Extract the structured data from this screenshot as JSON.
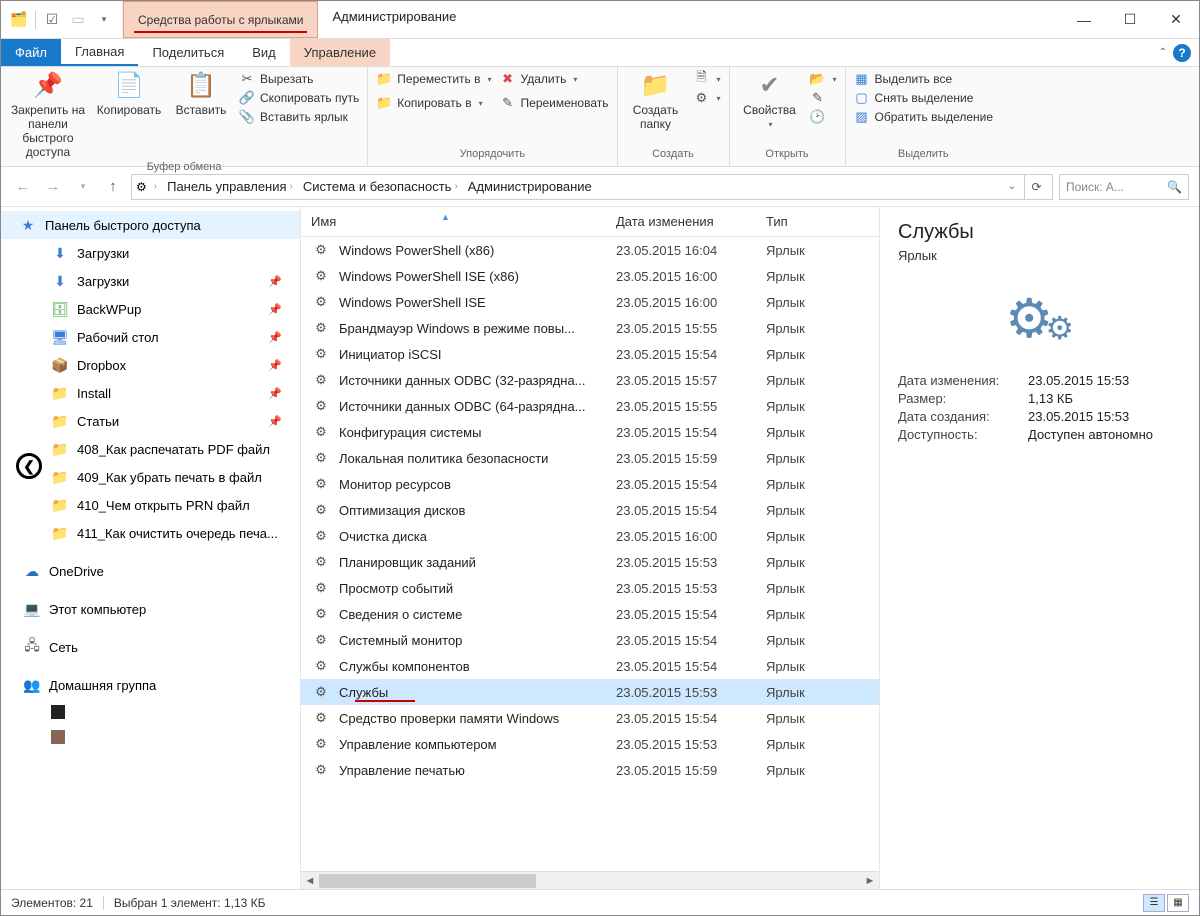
{
  "titlebar": {
    "context_tab": "Средства работы с ярлыками",
    "title": "Администрирование"
  },
  "tabs": {
    "file": "Файл",
    "home": "Главная",
    "share": "Поделиться",
    "view": "Вид",
    "manage": "Управление"
  },
  "ribbon": {
    "pin": "Закрепить на панели быстрого доступа",
    "copy": "Копировать",
    "paste": "Вставить",
    "cut": "Вырезать",
    "copy_path": "Скопировать путь",
    "paste_shortcut": "Вставить ярлык",
    "group_clipboard": "Буфер обмена",
    "move_to": "Переместить в",
    "copy_to": "Копировать в",
    "delete": "Удалить",
    "rename": "Переименовать",
    "group_organize": "Упорядочить",
    "new_folder": "Создать папку",
    "group_new": "Создать",
    "properties": "Свойства",
    "group_open": "Открыть",
    "select_all": "Выделить все",
    "select_none": "Снять выделение",
    "invert_selection": "Обратить выделение",
    "group_select": "Выделить"
  },
  "breadcrumb": {
    "level0": "Панель управления",
    "level1": "Система и безопасность",
    "level2": "Администрирование"
  },
  "search_placeholder": "Поиск: А...",
  "nav": {
    "quick_access": "Панель быстрого доступа",
    "downloads": "Загрузки",
    "backwpup": "BackWPup",
    "desktop": "Рабочий стол",
    "dropbox": "Dropbox",
    "install": "Install",
    "articles": "Статьи",
    "a408": "408_Как распечатать PDF файл",
    "a409": "409_Как убрать печать в файл",
    "a410": "410_Чем открыть PRN файл",
    "a411": "411_Как очистить очередь печа...",
    "onedrive": "OneDrive",
    "thispc": "Этот компьютер",
    "network": "Сеть",
    "homegroup": "Домашняя группа"
  },
  "headers": {
    "name": "Имя",
    "date": "Дата изменения",
    "type": "Тип"
  },
  "type_label": "Ярлык",
  "files": [
    {
      "name": "Windows PowerShell (x86)",
      "date": "23.05.2015 16:04"
    },
    {
      "name": "Windows PowerShell ISE (x86)",
      "date": "23.05.2015 16:00"
    },
    {
      "name": "Windows PowerShell ISE",
      "date": "23.05.2015 16:00"
    },
    {
      "name": "Брандмауэр Windows в режиме повы...",
      "date": "23.05.2015 15:55"
    },
    {
      "name": "Инициатор iSCSI",
      "date": "23.05.2015 15:54"
    },
    {
      "name": "Источники данных ODBC (32-разрядна...",
      "date": "23.05.2015 15:57"
    },
    {
      "name": "Источники данных ODBC (64-разрядна...",
      "date": "23.05.2015 15:55"
    },
    {
      "name": "Конфигурация системы",
      "date": "23.05.2015 15:54"
    },
    {
      "name": "Локальная политика безопасности",
      "date": "23.05.2015 15:59"
    },
    {
      "name": "Монитор ресурсов",
      "date": "23.05.2015 15:54"
    },
    {
      "name": "Оптимизация дисков",
      "date": "23.05.2015 15:54"
    },
    {
      "name": "Очистка диска",
      "date": "23.05.2015 16:00"
    },
    {
      "name": "Планировщик заданий",
      "date": "23.05.2015 15:53"
    },
    {
      "name": "Просмотр событий",
      "date": "23.05.2015 15:53"
    },
    {
      "name": "Сведения о системе",
      "date": "23.05.2015 15:54"
    },
    {
      "name": "Системный монитор",
      "date": "23.05.2015 15:54"
    },
    {
      "name": "Службы компонентов",
      "date": "23.05.2015 15:54"
    },
    {
      "name": "Службы",
      "date": "23.05.2015 15:53",
      "selected": true
    },
    {
      "name": "Средство проверки памяти Windows",
      "date": "23.05.2015 15:54"
    },
    {
      "name": "Управление компьютером",
      "date": "23.05.2015 15:53"
    },
    {
      "name": "Управление печатью",
      "date": "23.05.2015 15:59"
    }
  ],
  "preview": {
    "title": "Службы",
    "subtype": "Ярлык",
    "props": [
      {
        "label": "Дата изменения:",
        "value": "23.05.2015 15:53"
      },
      {
        "label": "Размер:",
        "value": "1,13 КБ"
      },
      {
        "label": "Дата создания:",
        "value": "23.05.2015 15:53"
      },
      {
        "label": "Доступность:",
        "value": "Доступен автономно"
      }
    ]
  },
  "status": {
    "count": "Элементов: 21",
    "selection": "Выбран 1 элемент: 1,13 КБ"
  }
}
